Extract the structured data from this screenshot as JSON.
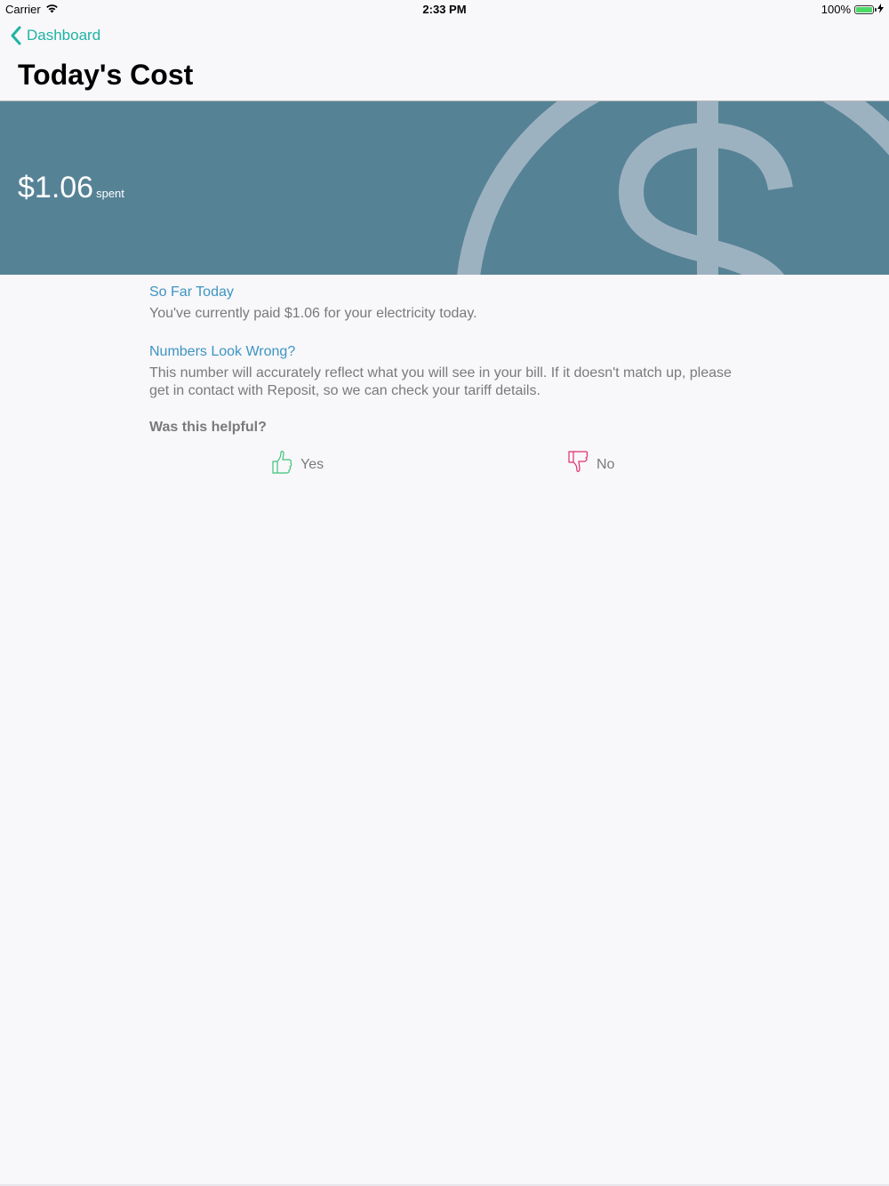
{
  "status_bar": {
    "carrier": "Carrier",
    "time": "2:33 PM",
    "battery": "100%",
    "battery_level": 1.0,
    "icons": [
      "wifi-icon",
      "battery-icon",
      "charging-icon"
    ]
  },
  "nav": {
    "back_label": "Dashboard",
    "back_icon": "chevron-left-icon",
    "title": "Today's Cost"
  },
  "banner": {
    "amount": "$1.06",
    "suffix": "spent",
    "background_icon": "dollar-sign-icon"
  },
  "sections": [
    {
      "heading": "So Far Today",
      "body": "You've currently paid $1.06 for your electricity today."
    },
    {
      "heading": "Numbers Look Wrong?",
      "body": "This number will accurately reflect what you will see in your bill. If it doesn't match up, please get in contact with Reposit, so we can check your tariff details."
    }
  ],
  "feedback": {
    "question": "Was this helpful?",
    "yes_label": "Yes",
    "no_label": "No",
    "yes_icon": "thumbs-up-icon",
    "no_icon": "thumbs-down-icon"
  },
  "colors": {
    "accent": "#1fb3a3",
    "heading": "#3d95c2",
    "banner": "#568296",
    "yes": "#3cc47a",
    "no": "#e0306a",
    "body_text": "#7a7a7a"
  }
}
